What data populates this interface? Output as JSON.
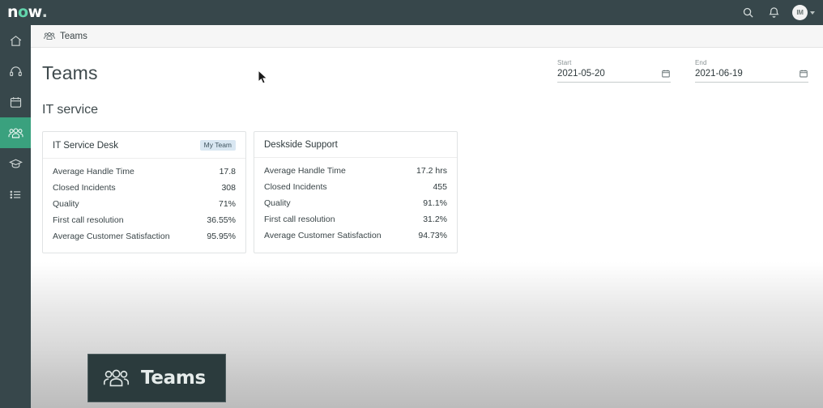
{
  "topbar": {
    "logo_text": "now",
    "logo_o": "o",
    "logo_dot": ".",
    "search_icon": "search-icon",
    "bell_icon": "bell-icon",
    "avatar_initials": "IM"
  },
  "rail": {
    "items": [
      {
        "name": "home",
        "icon": "home-icon",
        "active": false
      },
      {
        "name": "support",
        "icon": "headset-icon",
        "active": false
      },
      {
        "name": "calendar",
        "icon": "calendar-icon",
        "active": false
      },
      {
        "name": "teams",
        "icon": "people-icon",
        "active": true
      },
      {
        "name": "learning",
        "icon": "graduation-cap-icon",
        "active": false
      },
      {
        "name": "list",
        "icon": "list-icon",
        "active": false
      }
    ]
  },
  "breadcrumb": {
    "icon": "people-icon",
    "label": "Teams"
  },
  "main": {
    "page_title": "Teams",
    "section_title": "IT service"
  },
  "filters": {
    "start": {
      "label": "Start",
      "value": "2021-05-20",
      "placeholder": "yyyy-mm-dd",
      "icon": "calendar-icon"
    },
    "end": {
      "label": "End",
      "value": "2021-06-19",
      "placeholder": "yyyy-mm-dd",
      "icon": "calendar-icon"
    }
  },
  "cards": [
    {
      "title": "IT Service Desk",
      "badge": "My Team",
      "has_badge": true,
      "rows": [
        {
          "label": "Average Handle Time",
          "value": "17.8"
        },
        {
          "label": "Closed Incidents",
          "value": "308"
        },
        {
          "label": "Quality",
          "value": "71%"
        },
        {
          "label": "First call resolution",
          "value": "36.55%"
        },
        {
          "label": "Average Customer Satisfaction",
          "value": "95.95%"
        }
      ]
    },
    {
      "title": "Deskside Support",
      "badge": "",
      "has_badge": false,
      "rows": [
        {
          "label": "Average Handle Time",
          "value": "17.2 hrs"
        },
        {
          "label": "Closed Incidents",
          "value": "455"
        },
        {
          "label": "Quality",
          "value": "91.1%"
        },
        {
          "label": "First call resolution",
          "value": "31.2%"
        },
        {
          "label": "Average Customer Satisfaction",
          "value": "94.73%"
        }
      ]
    }
  ],
  "overlay": {
    "icon": "people-icon",
    "label": "Teams"
  },
  "colors": {
    "topbar": "#37474b",
    "accent_green": "#3aa17e",
    "logo_teal": "#62d4ac",
    "badge_bg": "#d9e7f2",
    "overlay_bg": "#2b3b3d"
  }
}
